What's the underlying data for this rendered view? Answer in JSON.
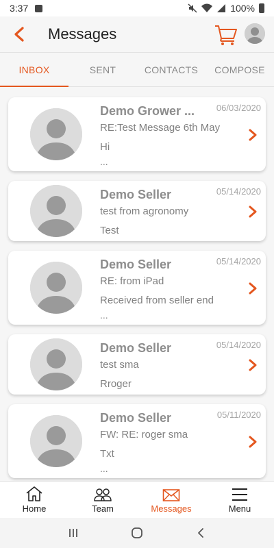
{
  "status_bar": {
    "time": "3:37",
    "battery": "100%"
  },
  "header": {
    "title": "Messages"
  },
  "tabs": [
    {
      "label": "INBOX",
      "active": true
    },
    {
      "label": "SENT",
      "active": false
    },
    {
      "label": "CONTACTS",
      "active": false
    },
    {
      "label": "COMPOSE",
      "active": false
    }
  ],
  "messages": [
    {
      "sender": "Demo Grower ...",
      "date": "06/03/2020",
      "subject": "RE:Test Message 6th May",
      "body": "Hi",
      "ellipsis": "..."
    },
    {
      "sender": "Demo Seller",
      "date": "05/14/2020",
      "subject": "test from agronomy",
      "body": "Test",
      "ellipsis": ""
    },
    {
      "sender": "Demo Seller",
      "date": "05/14/2020",
      "subject": "RE: from iPad",
      "body": "Received from seller end",
      "ellipsis": "..."
    },
    {
      "sender": "Demo Seller",
      "date": "05/14/2020",
      "subject": "test sma",
      "body": "Rroger",
      "ellipsis": ""
    },
    {
      "sender": "Demo Seller",
      "date": "05/11/2020",
      "subject": "FW: RE: roger sma",
      "body": "Txt",
      "ellipsis": "..."
    }
  ],
  "bottom_nav": [
    {
      "label": "Home",
      "icon": "home-icon",
      "active": false
    },
    {
      "label": "Team",
      "icon": "team-icon",
      "active": false
    },
    {
      "label": "Messages",
      "icon": "envelope-icon",
      "active": true
    },
    {
      "label": "Menu",
      "icon": "hamburger-icon",
      "active": false
    }
  ],
  "colors": {
    "accent": "#e4571f",
    "background": "#f6f6f6",
    "card": "#ffffff",
    "text_muted": "#8d8d8d"
  }
}
